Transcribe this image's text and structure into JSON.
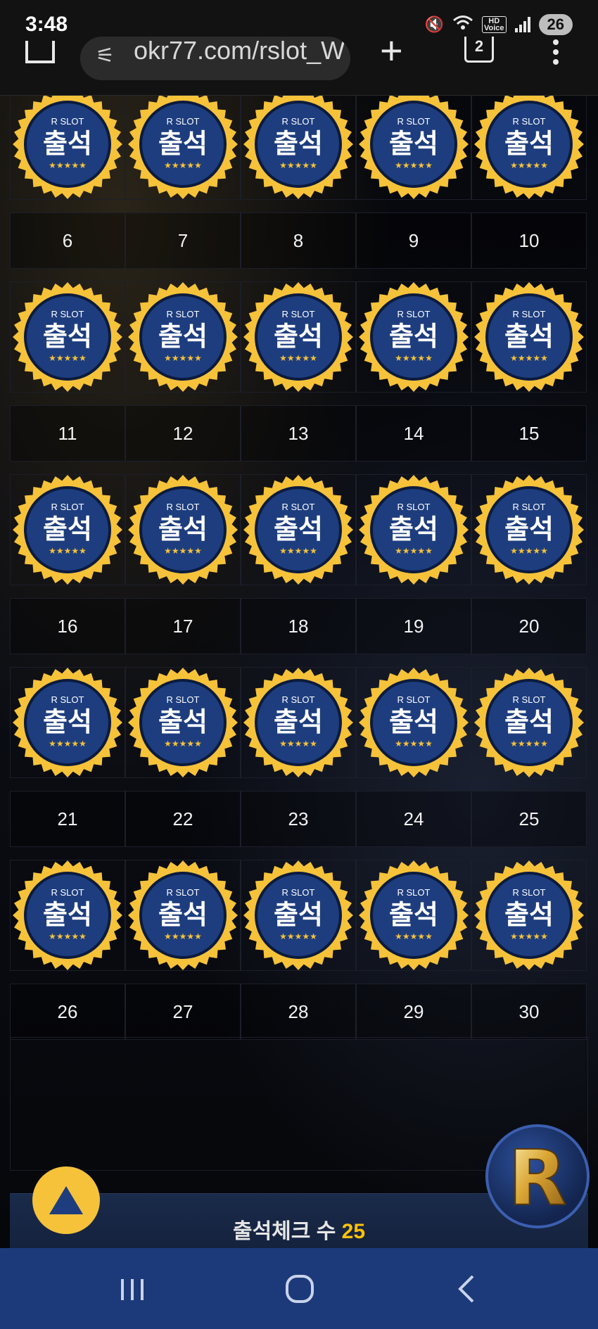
{
  "status_bar": {
    "time": "3:48",
    "hd_line1": "HD",
    "hd_line2": "Voice",
    "wifi_label": "5",
    "battery": "26"
  },
  "browser": {
    "url": "okr77.com/rslot_W",
    "tabs_count": "2"
  },
  "badge": {
    "brand": "R SLOT",
    "label": "출석",
    "stars": "★★★★★",
    "colors": {
      "ring": "#f5c23a",
      "disc": "#1d3d7e",
      "star": "#f5c23a"
    }
  },
  "calendar": {
    "rows": [
      {
        "days": [
          "6",
          "7",
          "8",
          "9",
          "10"
        ]
      },
      {
        "days": [
          "11",
          "12",
          "13",
          "14",
          "15"
        ]
      },
      {
        "days": [
          "16",
          "17",
          "18",
          "19",
          "20"
        ]
      },
      {
        "days": [
          "21",
          "22",
          "23",
          "24",
          "25"
        ]
      },
      {
        "days": [
          "26",
          "27",
          "28",
          "29",
          "30"
        ]
      }
    ]
  },
  "footer": {
    "label": "출석체크 수",
    "count": "25"
  },
  "logo": {
    "letter": "R"
  },
  "nav": {
    "recents_icon": "recent-apps-icon",
    "home_icon": "home-icon",
    "back_icon": "back-icon"
  }
}
